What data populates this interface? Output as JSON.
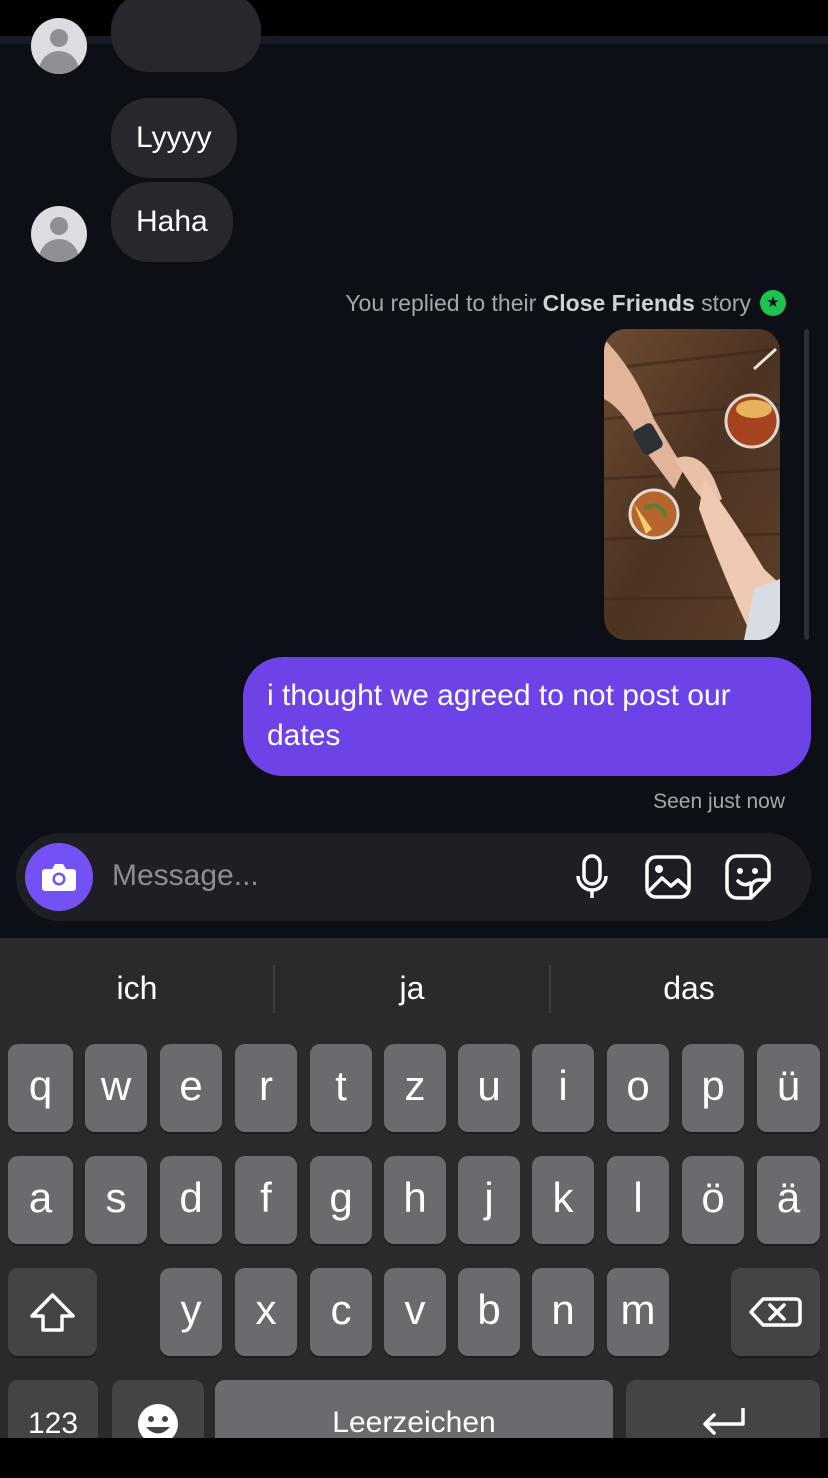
{
  "chat": {
    "messages_in": [
      {
        "text": "Lyyyy"
      },
      {
        "text": "Haha"
      }
    ],
    "story_reply": {
      "prefix": "You replied to their",
      "bold": "Close Friends",
      "suffix": "story"
    },
    "message_out": {
      "text": "i thought we agreed to not post our dates"
    },
    "seen": "Seen just now"
  },
  "composer": {
    "placeholder": "Message...",
    "camera_icon": "camera-icon",
    "mic_icon": "microphone-icon",
    "gallery_icon": "image-icon",
    "sticker_icon": "sticker-icon"
  },
  "keyboard": {
    "suggestions": [
      "ich",
      "ja",
      "das"
    ],
    "row1": [
      "q",
      "w",
      "e",
      "r",
      "t",
      "z",
      "u",
      "i",
      "o",
      "p",
      "ü"
    ],
    "row2": [
      "a",
      "s",
      "d",
      "f",
      "g",
      "h",
      "j",
      "k",
      "l",
      "ö",
      "ä"
    ],
    "row3": [
      "y",
      "x",
      "c",
      "v",
      "b",
      "n",
      "m"
    ],
    "numbers_label": "123",
    "space_label": "Leerzeichen",
    "shift_icon": "shift-icon",
    "delete_icon": "backspace-icon",
    "emoji_icon": "emoji-icon",
    "return_icon": "return-icon"
  },
  "colors": {
    "chat_bg": "#0c1016",
    "outgoing_bubble": "#6d43e8",
    "incoming_bubble": "#26282e",
    "close_friends_green": "#1ec24f",
    "camera_button": "#7451f4"
  }
}
